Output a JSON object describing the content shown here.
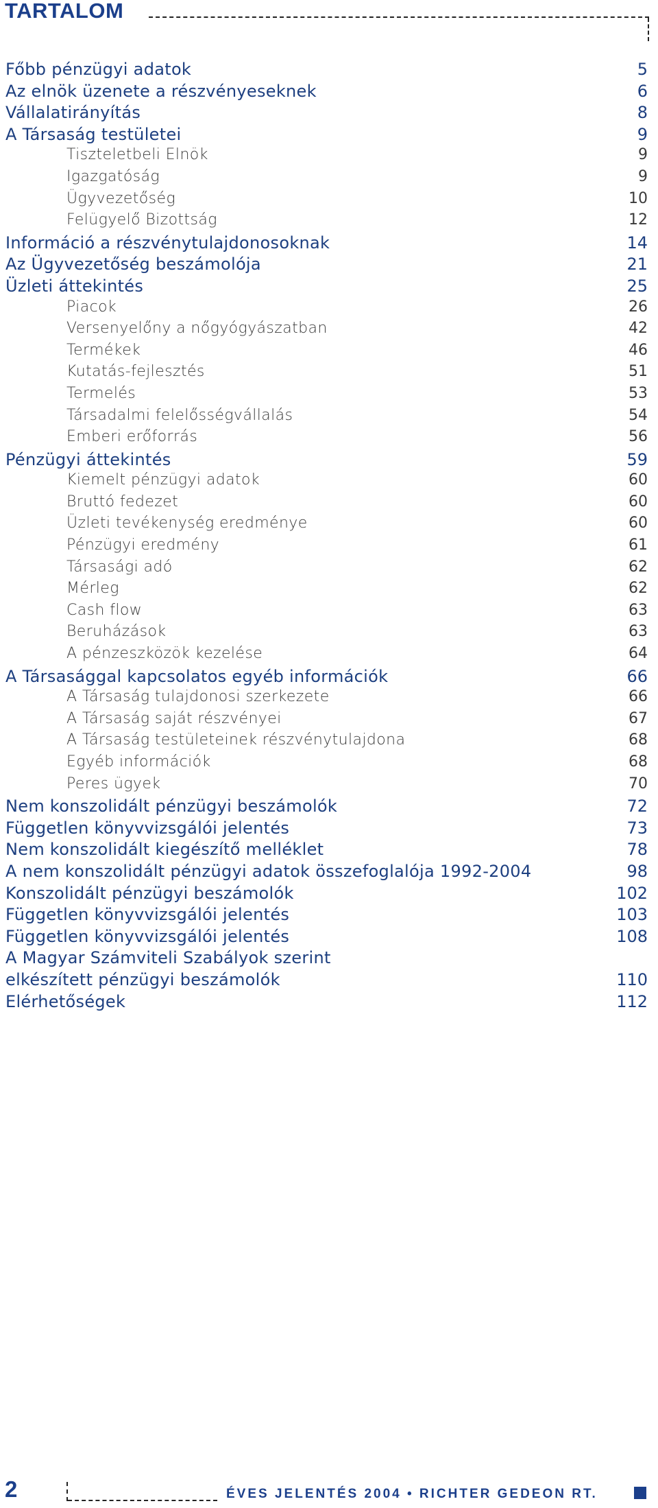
{
  "header": {
    "title": "TARTALOM"
  },
  "colors": {
    "primary": "#1b3f8b",
    "subitem": "#3a3a3a"
  },
  "toc": [
    {
      "label": "Főbb pénzügyi adatok",
      "page": "5",
      "level": 1
    },
    {
      "label": "Az elnök üzenete a részvényeseknek",
      "page": "6",
      "level": 1
    },
    {
      "label": "Vállalatirányítás",
      "page": "8",
      "level": 1
    },
    {
      "label": "A Társaság testületei",
      "page": "9",
      "level": 1
    },
    {
      "label": "Tiszteletbeli Elnök",
      "page": "9",
      "level": 2
    },
    {
      "label": "Igazgatóság",
      "page": "9",
      "level": 2
    },
    {
      "label": "Ügyvezetőség",
      "page": "10",
      "level": 2
    },
    {
      "label": "Felügyelő Bizottság",
      "page": "12",
      "level": 2
    },
    {
      "label": "Információ a részvénytulajdonosoknak",
      "page": "14",
      "level": 1
    },
    {
      "label": "Az Ügyvezetőség beszámolója",
      "page": "21",
      "level": 1
    },
    {
      "label": "Üzleti áttekintés",
      "page": "25",
      "level": 1
    },
    {
      "label": "Piacok",
      "page": "26",
      "level": 2
    },
    {
      "label": "Versenyelőny a nőgyógyászatban",
      "page": "42",
      "level": 2
    },
    {
      "label": "Termékek",
      "page": "46",
      "level": 2
    },
    {
      "label": "Kutatás-fejlesztés",
      "page": "51",
      "level": 2
    },
    {
      "label": "Termelés",
      "page": "53",
      "level": 2
    },
    {
      "label": "Társadalmi felelősségvállalás",
      "page": "54",
      "level": 2
    },
    {
      "label": "Emberi erőforrás",
      "page": "56",
      "level": 2
    },
    {
      "label": "Pénzügyi áttekintés",
      "page": "59",
      "level": 1
    },
    {
      "label": "Kiemelt pénzügyi adatok",
      "page": "60",
      "level": 2
    },
    {
      "label": "Bruttó fedezet",
      "page": "60",
      "level": 2
    },
    {
      "label": "Üzleti tevékenység eredménye",
      "page": "60",
      "level": 2
    },
    {
      "label": "Pénzügyi eredmény",
      "page": "61",
      "level": 2
    },
    {
      "label": "Társasági adó",
      "page": "62",
      "level": 2
    },
    {
      "label": "Mérleg",
      "page": "62",
      "level": 2
    },
    {
      "label": "Cash flow",
      "page": "63",
      "level": 2
    },
    {
      "label": "Beruházások",
      "page": "63",
      "level": 2
    },
    {
      "label": "A pénzeszközök kezelése",
      "page": "64",
      "level": 2
    },
    {
      "label": "A Társasággal kapcsolatos egyéb információk",
      "page": "66",
      "level": 1
    },
    {
      "label": "A Társaság tulajdonosi szerkezete",
      "page": "66",
      "level": 2
    },
    {
      "label": "A Társaság saját részvényei",
      "page": "67",
      "level": 2
    },
    {
      "label": "A Társaság testületeinek részvénytulajdona",
      "page": "68",
      "level": 2
    },
    {
      "label": "Egyéb információk",
      "page": "68",
      "level": 2
    },
    {
      "label": "Peres ügyek",
      "page": "70",
      "level": 2
    },
    {
      "label": "Nem konszolidált pénzügyi beszámolók",
      "page": "72",
      "level": 1
    },
    {
      "label": "Független könyvvizsgálói jelentés",
      "page": "73",
      "level": 1
    },
    {
      "label": "Nem konszolidált kiegészítő melléklet",
      "page": "78",
      "level": 1
    },
    {
      "label": "A nem konszolidált pénzügyi adatok összefoglalója 1992-2004",
      "page": "98",
      "level": 1
    },
    {
      "label": "Konszolidált pénzügyi beszámolók",
      "page": "102",
      "level": 1
    },
    {
      "label": "Független könyvvizsgálói jelentés",
      "page": "103",
      "level": 1
    },
    {
      "label": "Független könyvvizsgálói jelentés",
      "page": "108",
      "level": 1
    },
    {
      "label": "A Magyar Számviteli Szabályok szerint",
      "page": "",
      "level": 1
    },
    {
      "label": "elkészített pénzügyi beszámolók",
      "page": "110",
      "level": 1
    },
    {
      "label": "Elérhetőségek",
      "page": "112",
      "level": 1
    }
  ],
  "footer": {
    "page_number": "2",
    "running_title": "ÉVES JELENTÉS 2004 • RICHTER GEDEON RT."
  }
}
